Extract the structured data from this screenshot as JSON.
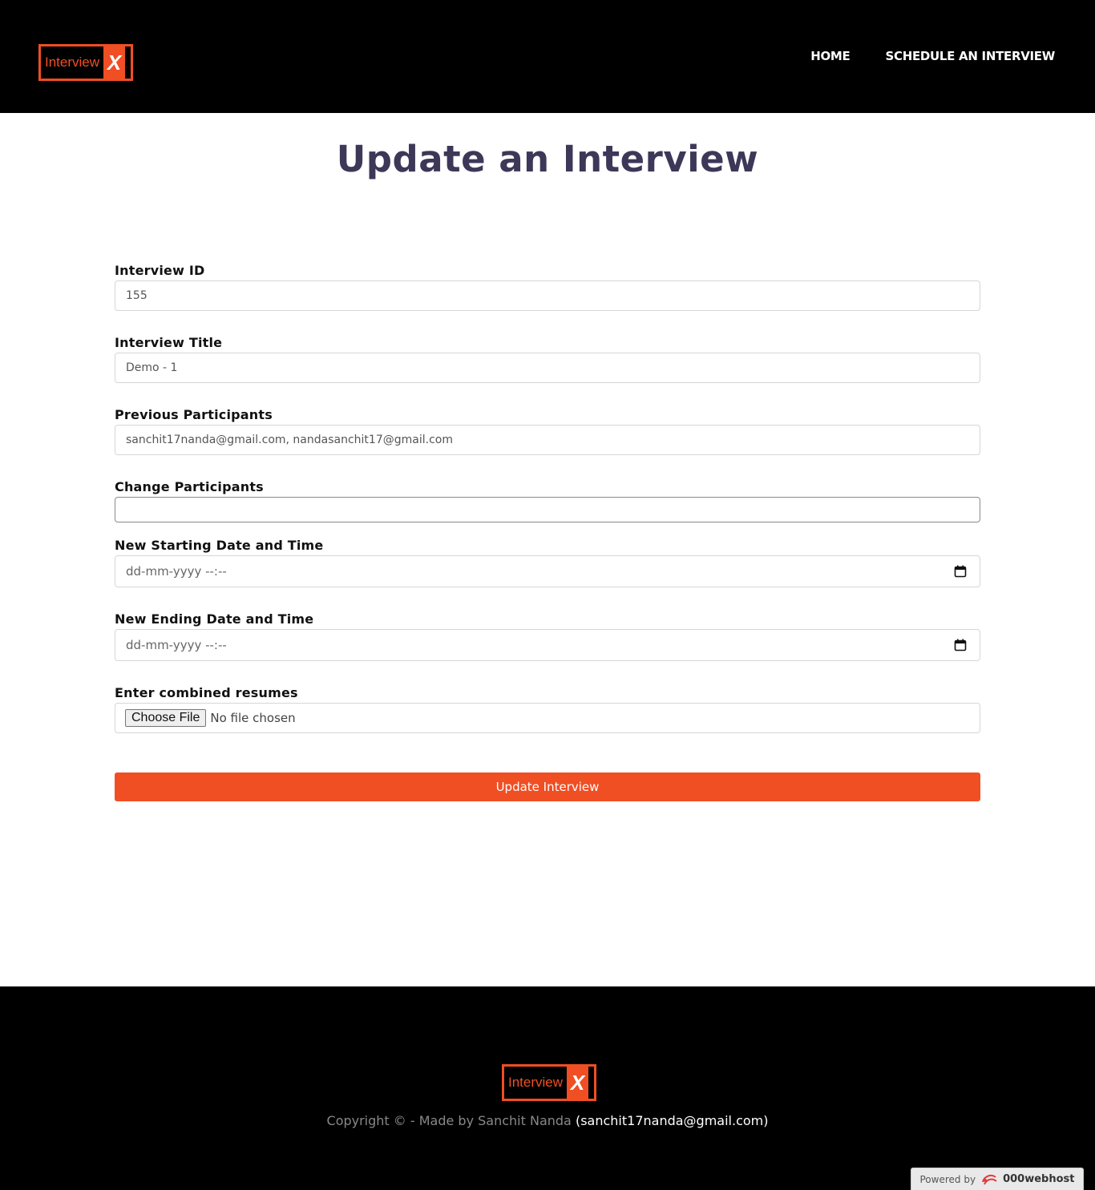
{
  "brand": {
    "logo_word": "Interview",
    "logo_mark": "X"
  },
  "nav": {
    "home": "HOME",
    "schedule": "SCHEDULE AN INTERVIEW"
  },
  "page": {
    "title": "Update an Interview"
  },
  "form": {
    "interview_id": {
      "label": "Interview ID",
      "value": "155"
    },
    "interview_title": {
      "label": "Interview Title",
      "value": "Demo - 1"
    },
    "previous_participants": {
      "label": "Previous Participants",
      "value": "sanchit17nanda@gmail.com, nandasanchit17@gmail.com"
    },
    "change_participants": {
      "label": "Change Participants",
      "value": ""
    },
    "new_start": {
      "label": "New Starting Date and Time",
      "placeholder": "dd-mm-yyyy --:--"
    },
    "new_end": {
      "label": "New Ending Date and Time",
      "placeholder": "dd-mm-yyyy --:--"
    },
    "resumes": {
      "label": "Enter combined resumes",
      "button": "Choose File",
      "status": "No file chosen"
    },
    "submit": "Update Interview"
  },
  "footer": {
    "copyright": "Copyright © - Made by Sanchit Nanda",
    "email": "(sanchit17nanda@gmail.com)",
    "powered_by": "Powered by",
    "host": "000webhost"
  },
  "colors": {
    "accent": "#f04e23",
    "title": "#3d3758",
    "header_bg": "#000000"
  },
  "icons": [
    "calendar-icon",
    "webhost-logo-icon"
  ]
}
